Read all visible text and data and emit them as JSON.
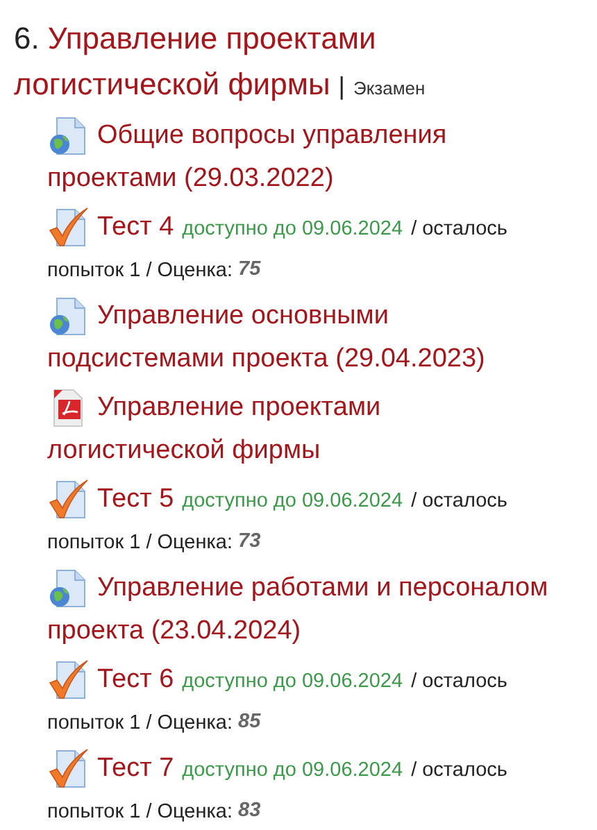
{
  "section": {
    "number": "6.",
    "title_lines": [
      "Управление проектами",
      "логистической фирмы"
    ],
    "separator": "|",
    "tag": "Экзамен"
  },
  "items": [
    {
      "kind": "page",
      "title_lines": [
        "Общие вопросы управления",
        "проектами (29.03.2022)"
      ]
    },
    {
      "kind": "quiz",
      "title": "Тест 4",
      "availability": "доступно до 09.06.2024",
      "attempts": "/ осталось",
      "attempts_rest": "попыток 1 / Оценка:",
      "grade": "75"
    },
    {
      "kind": "page",
      "title_lines": [
        "Управление основными",
        "подсистемами проекта (29.04.2023)"
      ]
    },
    {
      "kind": "pdf",
      "title_lines": [
        "Управление проектами",
        "логистической фирмы"
      ]
    },
    {
      "kind": "quiz",
      "title": "Тест 5",
      "availability": "доступно до 09.06.2024",
      "attempts": "/ осталось",
      "attempts_rest": "попыток 1 / Оценка:",
      "grade": "73"
    },
    {
      "kind": "page",
      "title_lines": [
        "Управление работами и персоналом",
        "проекта (23.04.2024)"
      ]
    },
    {
      "kind": "quiz",
      "title": "Тест 6",
      "availability": "доступно до 09.06.2024",
      "attempts": "/ осталось",
      "attempts_rest": "попыток 1 / Оценка:",
      "grade": "85"
    },
    {
      "kind": "quiz",
      "title": "Тест 7",
      "availability": "доступно до 09.06.2024",
      "attempts": "/ осталось",
      "attempts_rest": "попыток 1 / Оценка:",
      "grade": "83"
    }
  ]
}
